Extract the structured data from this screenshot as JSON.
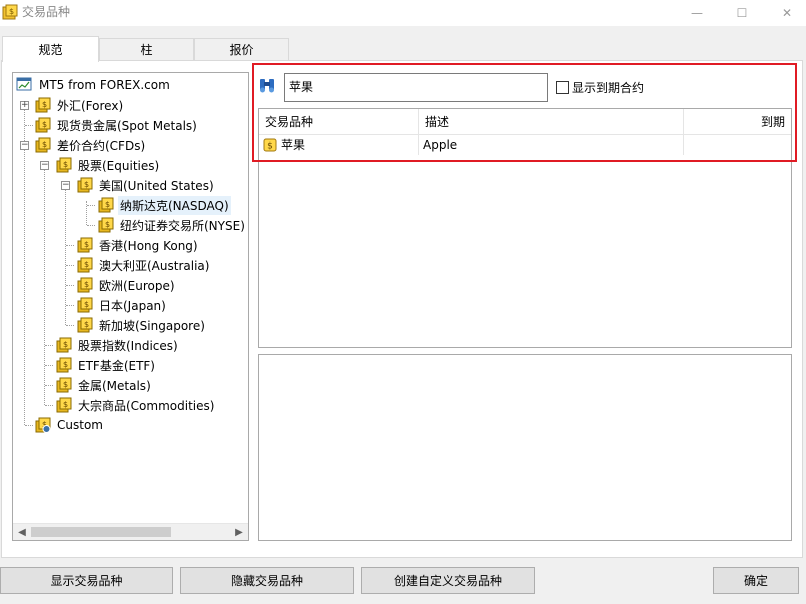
{
  "window": {
    "title": "交易品种",
    "minimize": "—",
    "maximize": "☐",
    "close": "✕"
  },
  "tabs": [
    {
      "label": "规范",
      "active": true
    },
    {
      "label": "柱",
      "active": false
    },
    {
      "label": "报价",
      "active": false
    }
  ],
  "tree": {
    "root": "MT5 from FOREX.com",
    "items": {
      "forex": "外汇(Forex)",
      "spot_metals": "现货贵金属(Spot Metals)",
      "cfds": "差价合约(CFDs)",
      "equities": "股票(Equities)",
      "us": "美国(United States)",
      "nasdaq": "纳斯达克(NASDAQ)",
      "nyse": "纽约证券交易所(NYSE)",
      "hk": "香港(Hong Kong)",
      "au": "澳大利亚(Australia)",
      "eu": "欧洲(Europe)",
      "jp": "日本(Japan)",
      "sg": "新加坡(Singapore)",
      "indices": "股票指数(Indices)",
      "etf": "ETF基金(ETF)",
      "metals": "金属(Metals)",
      "commodities": "大宗商品(Commodities)",
      "custom": "Custom"
    }
  },
  "search": {
    "value": "苹果",
    "show_expired_label": "显示到期合约"
  },
  "list": {
    "columns": [
      "交易品种",
      "描述",
      "到期"
    ],
    "rows": [
      {
        "symbol": "苹果",
        "description": "Apple",
        "expiry": ""
      }
    ]
  },
  "buttons": {
    "show": "显示交易品种",
    "hide": "隐藏交易品种",
    "create_custom": "创建自定义交易品种",
    "ok": "确定"
  },
  "colors": {
    "highlight": "#e01b24",
    "folder_gold": "#f2c230"
  }
}
